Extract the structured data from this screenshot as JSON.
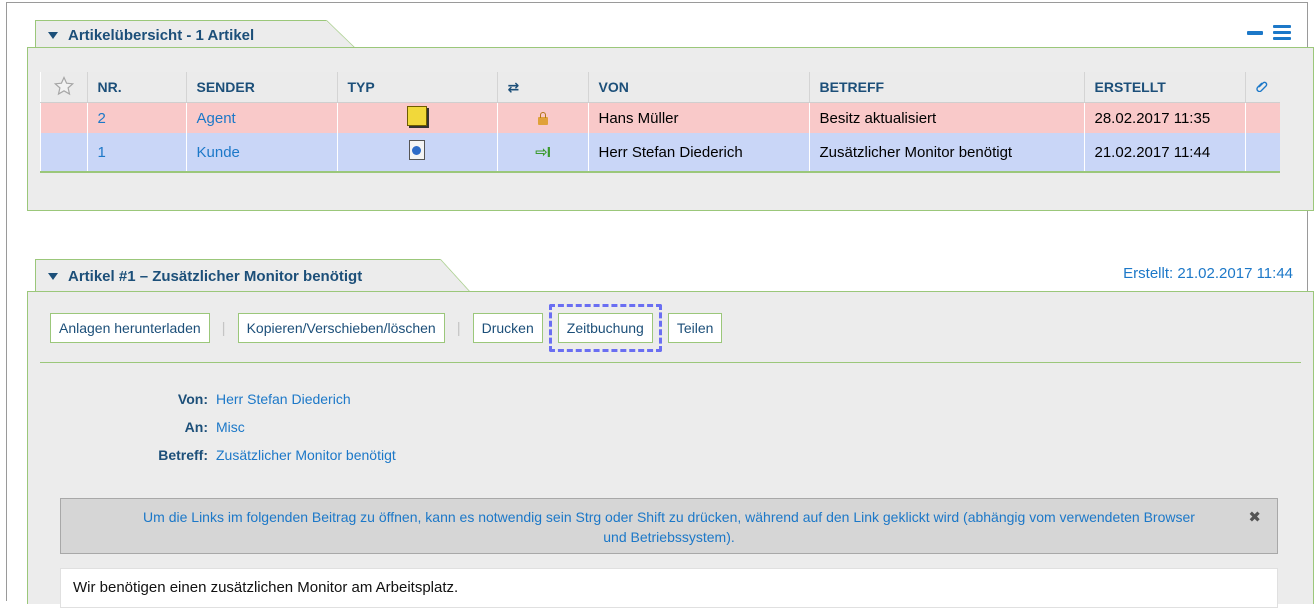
{
  "overview": {
    "title": "Artikelübersicht - 1 Artikel",
    "columns": [
      "NR.",
      "SENDER",
      "TYP",
      "⇄",
      "VON",
      "BETREFF",
      "ERSTELLT"
    ],
    "rows": [
      {
        "nr": "2",
        "sender": "Agent",
        "type_icon": "note-icon",
        "direction_icon": "lock-icon",
        "from": "Hans Müller",
        "subject": "Besitz aktualisiert",
        "created": "28.02.2017 11:35",
        "color": "#f9c9c9"
      },
      {
        "nr": "1",
        "sender": "Kunde",
        "type_icon": "email-icon",
        "direction_icon": "incoming-arrow-icon",
        "from": "Herr Stefan Diederich",
        "subject": "Zusätzlicher Monitor benötigt",
        "created": "21.02.2017 11:44",
        "color": "#c9d6f7"
      }
    ],
    "icons": {
      "star": "star-icon",
      "attachment": "paperclip-icon",
      "collapse": "minus-icon",
      "options": "menu-icon"
    }
  },
  "article": {
    "title": "Artikel #1 – Zusätzlicher Monitor benötigt",
    "created": "Erstellt: 21.02.2017 11:44",
    "actions": {
      "download": "Anlagen herunterladen",
      "copy_move": "Kopieren/Verschieben/löschen",
      "print": "Drucken",
      "time": "Zeitbuchung",
      "share": "Teilen"
    },
    "meta": {
      "from_label": "Von:",
      "from_value": "Herr Stefan Diederich",
      "to_label": "An:",
      "to_value": "Misc",
      "subject_label": "Betreff:",
      "subject_value": "Zusätzlicher Monitor benötigt"
    },
    "notice": "Um die Links im folgenden Beitrag zu öffnen, kann es notwendig sein Strg oder Shift zu drücken, während auf den Link geklickt wird (abhängig vom verwendeten Browser und Betriebssystem).",
    "body": "Wir benötigen einen zusätzlichen Monitor am Arbeitsplatz."
  },
  "colors": {
    "accent": "#1c78c8",
    "header_text": "#1c4f79",
    "border_green": "#9bc77a",
    "highlight": "#6a6ef2"
  }
}
